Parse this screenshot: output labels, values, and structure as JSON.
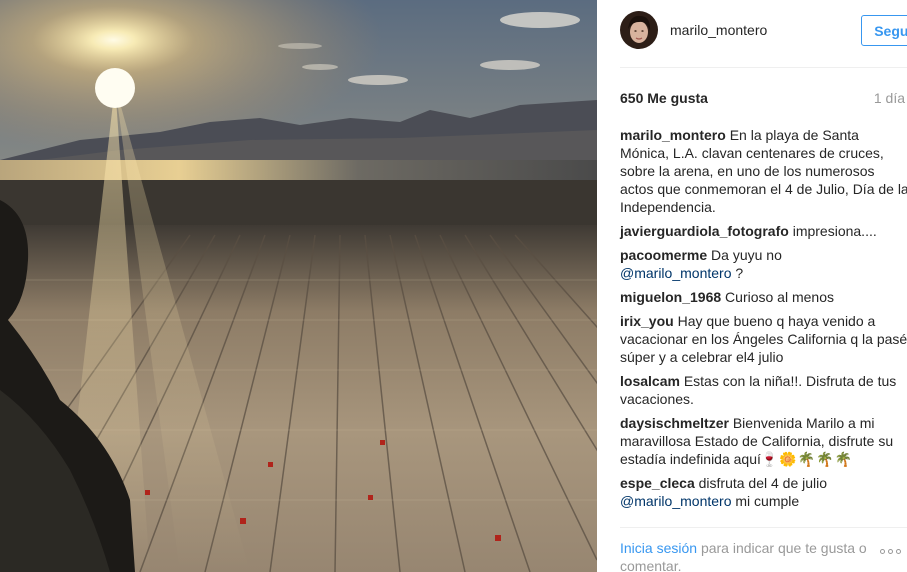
{
  "header": {
    "username": "marilo_montero",
    "follow_label": "Seguir"
  },
  "stats": {
    "likes": "650 Me gusta",
    "time": "1 día"
  },
  "caption": {
    "user": "marilo_montero",
    "text": "En la playa de Santa Mónica, L.A. clavan centenares de cruces, sobre la arena, en uno de los numerosos actos que conmemoran el 4 de Julio, Día de la Independencia."
  },
  "comments": [
    {
      "user": "javierguardiola_fotografo",
      "text": "impresiona...."
    },
    {
      "user": "pacoomerme",
      "text": "Da yuyu no",
      "mention": "@marilo_montero",
      "after": " ?"
    },
    {
      "user": "miguelon_1968",
      "text": "Curioso al menos"
    },
    {
      "user": "irix_you",
      "text": "Hay que bueno q haya venido a vacacionar en los Ángeles California q la pasé súper y a celebrar el4 julio"
    },
    {
      "user": "losalcam",
      "text": "Estas con la niña!!. Disfruta de tus vacaciones."
    },
    {
      "user": "daysischmeltzer",
      "text": "Bienvenida Marilo a mi maravillosa Estado de California, disfrute su estadía indefinida aquí",
      "emoji": "🍷🌼🌴🌴🌴"
    },
    {
      "user": "espe_cleca",
      "text": "disfruta del 4 de julio",
      "mention": "@marilo_montero",
      "after": " mi cumple"
    }
  ],
  "footer": {
    "login_link": "Inicia sesión",
    "text": "para indicar que te gusta o comentar."
  }
}
